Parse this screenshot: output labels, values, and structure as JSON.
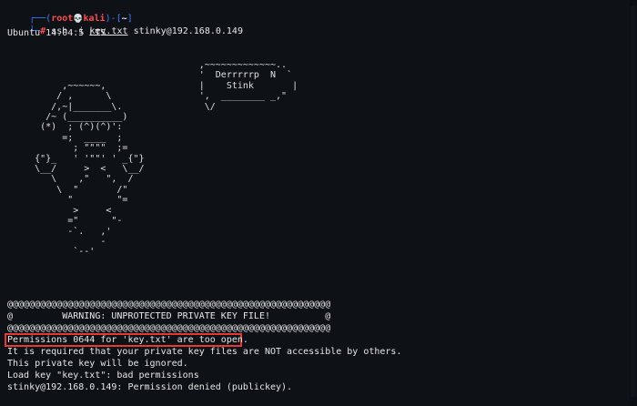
{
  "prompt": {
    "corner_top": "┌──(",
    "user": "root",
    "skull": "💀",
    "host": "kali",
    "mid": ")-[",
    "path": "~",
    "end": "]",
    "corner_bottom": "└─",
    "hash": "#",
    "cmd_ssh": "ssh",
    "cmd_flag": "-i",
    "cmd_key": "key.txt",
    "cmd_target": "stinky@192.168.0.149"
  },
  "banner": "Ubuntu 14.04.5 LTS",
  "ascii_art": "                                   ,~~~~~~~~~~~~~..\n                                   '  Derrrrrp  N  `\n          ,~~~~~~,                 |    Stink       |\n         / ,      \\                ',  ________ _,\"\n        /,~|_______\\.               \\/\n       /~ (__________)\n      (*)  ; (^)(^)':\n          =;  ____  ;\n            ; \"\"\"\"  ;=\n     {\"}_   ' '\"\"' ' _{\"}\n     \\__/     >  <   \\__/\n        \\    ,\"   \",  /\n         \\  \"       /\"\n           \"        \"=\n            >     <\n           =\"      \"-\n           -`.   ,'\n                 -\n            `--'",
  "warning_lines": [
    "@@@@@@@@@@@@@@@@@@@@@@@@@@@@@@@@@@@@@@@@@@@@@@@@@@@@@@@@@@@",
    "@         WARNING: UNPROTECTED PRIVATE KEY FILE!          @",
    "@@@@@@@@@@@@@@@@@@@@@@@@@@@@@@@@@@@@@@@@@@@@@@@@@@@@@@@@@@@"
  ],
  "output_lines": [
    "Permissions 0644 for 'key.txt' are too open.",
    "It is required that your private key files are NOT accessible by others.",
    "This private key will be ignored.",
    "Load key \"key.txt\": bad permissions",
    "stinky@192.168.0.149: Permission denied (publickey)."
  ],
  "colors": {
    "background": "#0e1116",
    "prompt_blue": "#3a7bff",
    "prompt_red": "#ff4b4b",
    "highlight_box": "#e53935"
  }
}
